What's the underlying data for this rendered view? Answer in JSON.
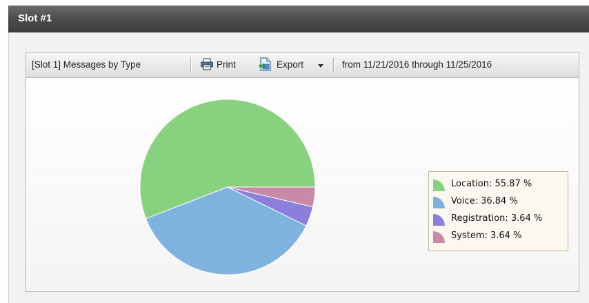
{
  "slot": {
    "title": "Slot #1"
  },
  "toolbar": {
    "report_title": "[Slot 1] Messages by Type",
    "print_label": "Print",
    "print_icon": "printer-icon",
    "export_label": "Export",
    "export_icon": "export-document-icon",
    "export_dropdown_icon": "caret-down-icon",
    "date_range": "from 11/21/2016 through 11/25/2016"
  },
  "chart_data": {
    "type": "pie",
    "title": "",
    "legend_position": "right",
    "slices": [
      {
        "label": "Location",
        "value": 55.87,
        "color": "#88d17f",
        "legend_text": "Location: 55.87 %"
      },
      {
        "label": "Voice",
        "value": 36.84,
        "color": "#7db3de",
        "legend_text": "Voice: 36.84 %"
      },
      {
        "label": "Registration",
        "value": 3.64,
        "color": "#8b7fdb",
        "legend_text": "Registration: 3.64 %"
      },
      {
        "label": "System",
        "value": 3.64,
        "color": "#c98aa8",
        "legend_text": "System: 3.64 %"
      }
    ]
  }
}
